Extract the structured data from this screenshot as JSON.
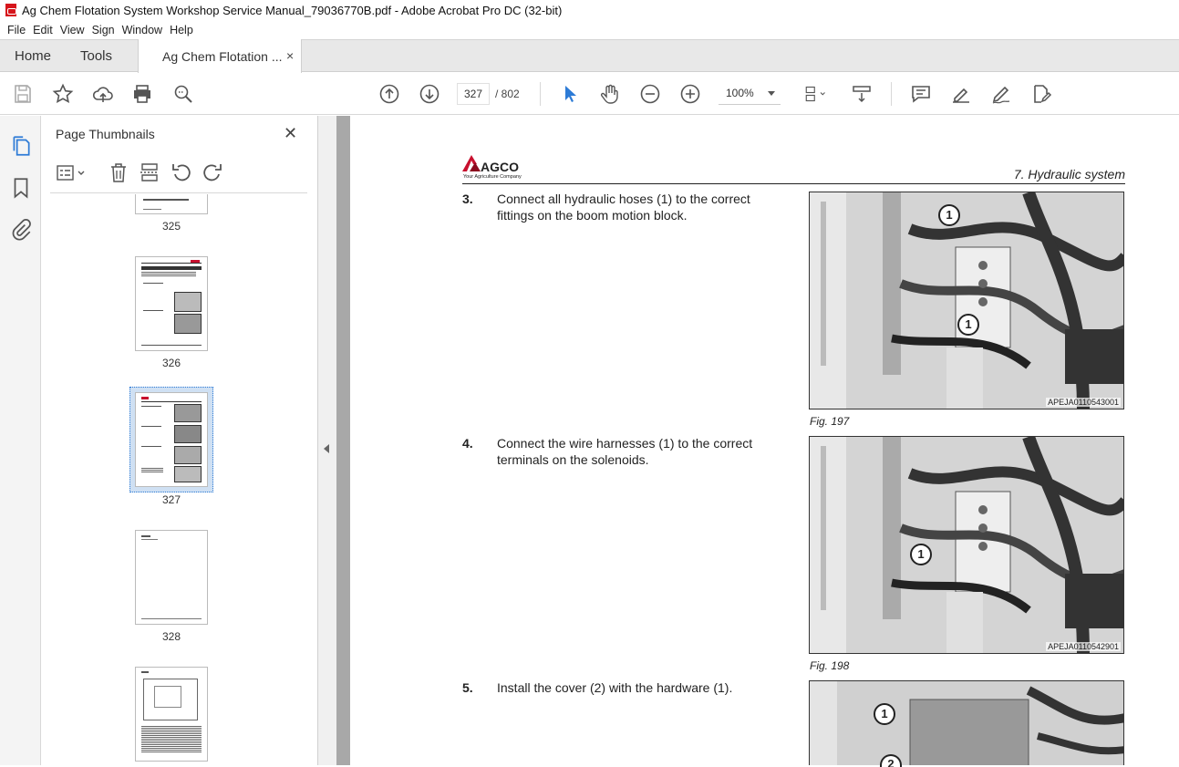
{
  "window": {
    "title": "Ag Chem Flotation System Workshop Service Manual_79036770B.pdf - Adobe Acrobat Pro DC (32-bit)"
  },
  "menu": [
    "File",
    "Edit",
    "View",
    "Sign",
    "Window",
    "Help"
  ],
  "tabs": {
    "home": "Home",
    "tools": "Tools",
    "document": "Ag Chem Flotation ...",
    "close": "×"
  },
  "toolbar": {
    "current_page": "327",
    "total_pages": "/ 802",
    "zoom": "100%"
  },
  "panel": {
    "title": "Page Thumbnails",
    "close": "✕",
    "thumbnails": [
      {
        "label": "325"
      },
      {
        "label": "326"
      },
      {
        "label": "327",
        "selected": true
      },
      {
        "label": "328"
      },
      {
        "label": ""
      }
    ]
  },
  "document": {
    "logo_text": "AGCO",
    "logo_tagline": "Your Agriculture Company",
    "section": "7. Hydraulic system",
    "steps": [
      {
        "number": "3.",
        "text": "Connect all hydraulic hoses (1) to the correct fittings on the boom motion block.",
        "figure_code": "APEJA0110543001",
        "caption": "Fig. 197"
      },
      {
        "number": "4.",
        "text": "Connect the wire harnesses (1) to the correct terminals on the solenoids.",
        "figure_code": "APEJA0110542901",
        "caption": "Fig. 198"
      },
      {
        "number": "5.",
        "text": "Install the cover (2) with the hardware (1).",
        "figure_code": "",
        "caption": ""
      }
    ],
    "callouts": [
      "1",
      "1",
      "1",
      "1",
      "2"
    ]
  },
  "colors": {
    "accent": "#2d7bd6",
    "agco_red": "#c8102e",
    "pdf_red": "#d6141b",
    "viewer_bg": "#a8a8a8"
  }
}
